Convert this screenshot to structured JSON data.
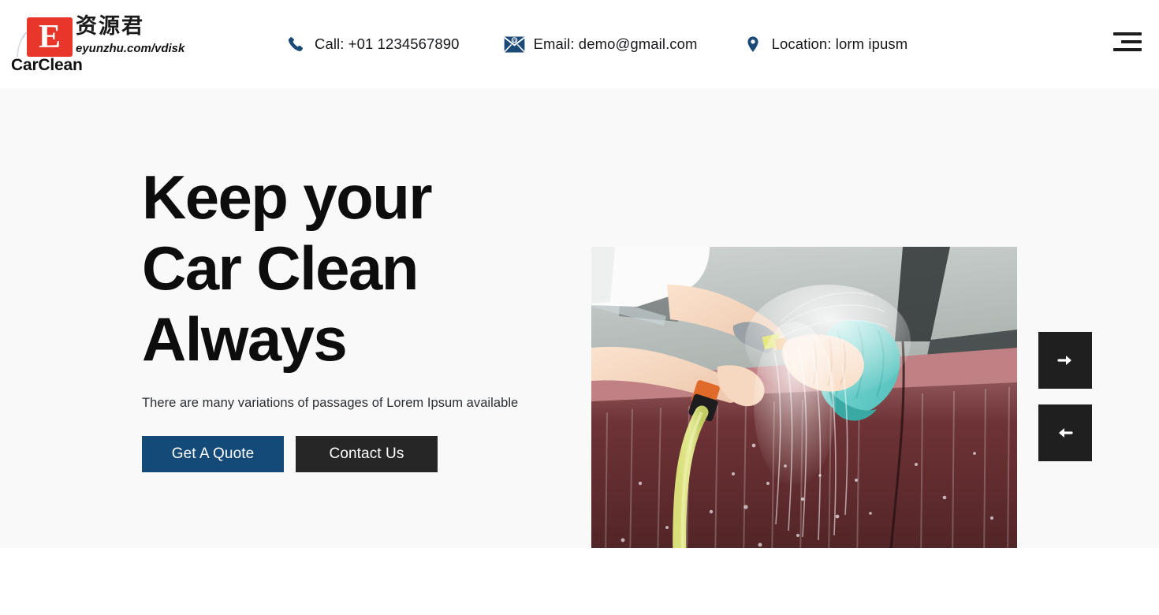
{
  "header": {
    "brand_name": "CarClean",
    "watermark": {
      "logo_letter": "E",
      "cn_text": "资源君",
      "url_text": "eyunzhu.com/vdisk"
    },
    "contacts": [
      {
        "icon": "phone-icon",
        "text": "Call: +01 1234567890"
      },
      {
        "icon": "envelope-at-icon",
        "text": "Email: demo@gmail.com"
      },
      {
        "icon": "map-pin-icon",
        "text": "Location: lorm ipusm"
      }
    ],
    "menu_icon": "hamburger-menu-icon"
  },
  "hero": {
    "title_lines": [
      "Keep your",
      "Car Clean",
      "Always"
    ],
    "subtitle": "There are many variations of passages of Lorem Ipsum available",
    "buttons": {
      "primary_label": "Get A Quote",
      "secondary_label": "Contact Us"
    },
    "image_alt": "Person washing a dark red car with a garden hose and a teal microfiber cloth",
    "slider": {
      "next_icon": "arrow-right-icon",
      "prev_icon": "arrow-left-icon"
    }
  },
  "colors": {
    "page_background": "#ffffff",
    "hero_background": "#f9f9f9",
    "accent_blue": "#134a78",
    "dark": "#262626",
    "icon_navy": "#1b4a77",
    "watermark_red": "#e8362a",
    "text_primary": "#0d0d0d"
  }
}
